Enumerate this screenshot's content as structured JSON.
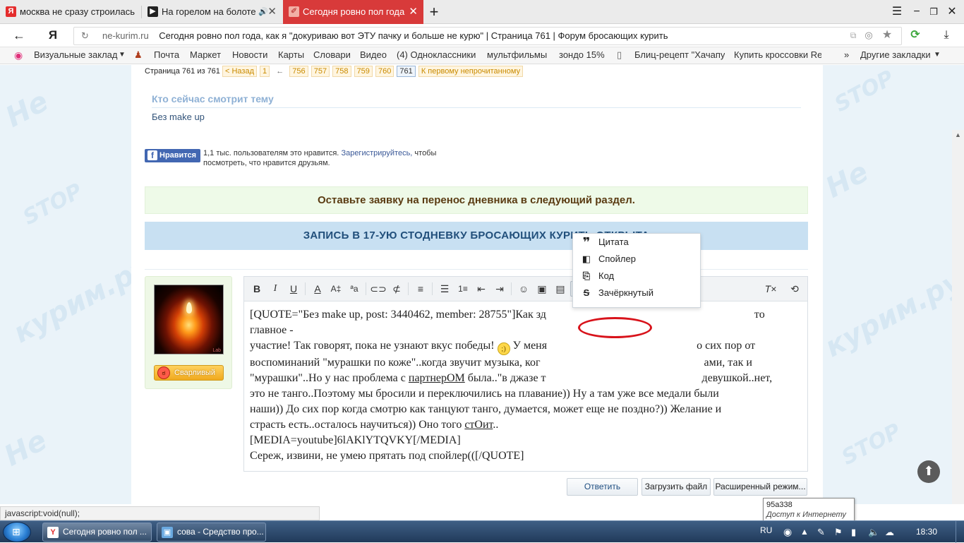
{
  "browser": {
    "tabs": [
      {
        "title": "москва не сразу строилась",
        "favicon": "Я",
        "color": "#e42d2d",
        "active": false
      },
      {
        "title": "На горелом на болоте",
        "favicon": "▶",
        "color": "#222222",
        "active": false,
        "sound": "🔊"
      },
      {
        "title": "Сегодня ровно пол года",
        "favicon": "✐",
        "color": "#ffffff",
        "active": true
      }
    ],
    "new_tab": "+",
    "address": {
      "domain": "ne-kurim.ru",
      "title": "Сегодня ровно пол года, как я \"докуриваю вот ЭТУ пачку и больше не курю\" | Страница 761 | Форум бросающих курить"
    },
    "bookmarks": [
      "Визуальные заклад",
      "Почта",
      "Маркет",
      "Новости",
      "Карты",
      "Словари",
      "Видео",
      "(4) Одноклассники",
      "мультфильмы",
      "зондо 15%",
      "Блиц-рецепт \"Хачапу",
      "Купить кроссовки Re",
      "Другие закладки"
    ]
  },
  "pager": {
    "label": "Страница 761 из 761",
    "prev": "< Назад",
    "first": "1",
    "ellipsis": "←",
    "pages": [
      "756",
      "757",
      "758",
      "759",
      "760",
      "761"
    ],
    "unread": "К первому непрочитанному"
  },
  "watchers": {
    "title": "Кто сейчас смотрит тему",
    "users": "Без make up"
  },
  "facebook": {
    "button": "Нравится",
    "count_text": "1,1 тыс. пользователям это нравится.",
    "link": "Зарегистрируйтесь,",
    "rest": "чтобы посмотреть, что нравится друзьям."
  },
  "notices": {
    "diary": "Оставьте заявку на перенос дневника в следующий раздел.",
    "enrollment": "ЗАПИСЬ В 17-УЮ СТОДНЕВКУ БРОСАЮЩИХ КУРИТЬ ОТКРЫТА"
  },
  "user": {
    "mood": "Сварливый",
    "avatar_caption": "Lab"
  },
  "editor": {
    "lines": [
      "[QUOTE=\"Без make up, post: 3440462, member: 28755\"]Как зд",
      "то главное -",
      "участие! Так говорят, пока не узнают вкус победы!",
      "У меня",
      "о сих пор от",
      "воспоминаний \"мурашки по коже\"..когда звучит музыка, ког",
      "ами, так и",
      "\"мурашки\"..Но у нас проблема с",
      "партнерОМ",
      "была..\"в джазе т",
      "девушкой..нет,",
      "это не танго..Поэтому мы бросили и переключились на плавание)) Ну а там уже все медали были",
      "наши)) До сих пор когда смотрю как танцуют танго, думается, может еще не поздно?)) Желание и",
      "страсть есть..осталось научиться)) Оно того",
      "стОит",
      "..",
      "[MEDIA=youtube]6lAKlYTQVKY[/MEDIA]",
      "Сереж, извини, не умею прятать под спойлер(([/QUOTE]"
    ]
  },
  "dropdown": {
    "items": [
      {
        "label": "Цитата",
        "icon": "quote-icon"
      },
      {
        "label": "Спойлер",
        "icon": "spoiler-icon"
      },
      {
        "label": "Код",
        "icon": "code-icon"
      },
      {
        "label": "Зачёркнутый",
        "icon": "strikethrough-icon"
      }
    ]
  },
  "actions": {
    "reply": "Ответить",
    "upload": "Загрузить файл",
    "advanced": "Расширенный режим..."
  },
  "statusbar": "javascript:void(null);",
  "tooltip": {
    "line1": "95a338",
    "line2": "Доступ к Интернету"
  },
  "taskbar": {
    "items": [
      {
        "title": "Сегодня ровно пол ..."
      },
      {
        "title": "сова - Средство про..."
      }
    ],
    "lang": "RU",
    "time": "18:30"
  }
}
